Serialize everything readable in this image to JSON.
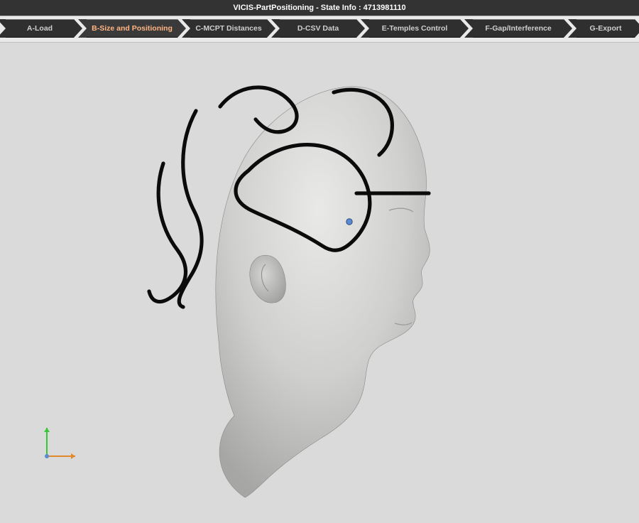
{
  "header": {
    "title": "VICIS-PartPositioning - State Info : 4713981110"
  },
  "steps": [
    {
      "label": "A-Load",
      "active": false
    },
    {
      "label": "B-Size and Positioning",
      "active": true
    },
    {
      "label": "C-MCPT Distances",
      "active": false
    },
    {
      "label": "D-CSV Data",
      "active": false
    },
    {
      "label": "E-Temples Control",
      "active": false
    },
    {
      "label": "F-Gap/Interference",
      "active": false
    },
    {
      "label": "G-Export",
      "active": false
    }
  ],
  "viewport": {
    "axis_triad": {
      "x_color": "#e08a2a",
      "y_color": "#36c636"
    },
    "marker_point_color": "#5a8ad0"
  }
}
